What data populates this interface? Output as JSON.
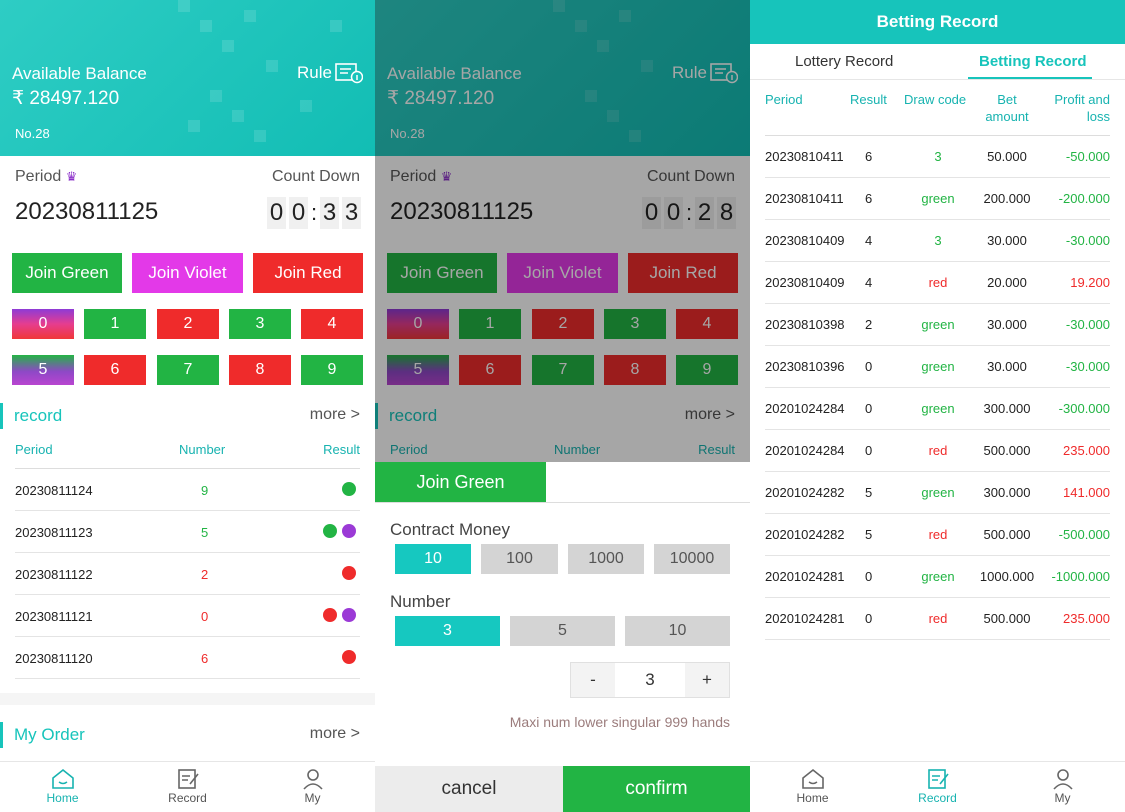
{
  "home": {
    "balance_label": "Available Balance",
    "balance_value": "₹ 28497.120",
    "rule_label": "Rule",
    "no_label": "No.28",
    "period_label": "Period",
    "countdown_label": "Count Down",
    "period_number": "20230811125",
    "countdown": [
      "0",
      "0",
      "3",
      "3"
    ],
    "join_buttons": [
      {
        "label": "Join Green"
      },
      {
        "label": "Join Violet"
      },
      {
        "label": "Join Red"
      }
    ],
    "numbers": [
      "0",
      "1",
      "2",
      "3",
      "4",
      "5",
      "6",
      "7",
      "8",
      "9"
    ],
    "record_title": "record",
    "more_label": "more >",
    "record_headers": {
      "period": "Period",
      "number": "Number",
      "result": "Result"
    },
    "records": [
      {
        "period": "20230811124",
        "number": "9",
        "num_color": "#22b444",
        "dots": [
          "#22b444"
        ]
      },
      {
        "period": "20230811123",
        "number": "5",
        "num_color": "#22b444",
        "dots": [
          "#22b444",
          "#9b3ad6"
        ]
      },
      {
        "period": "20230811122",
        "number": "2",
        "num_color": "#ef2b2b",
        "dots": [
          "#ef2b2b"
        ]
      },
      {
        "period": "20230811121",
        "number": "0",
        "num_color": "#ef2b2b",
        "dots": [
          "#ef2b2b",
          "#9b3ad6"
        ]
      },
      {
        "period": "20230811120",
        "number": "6",
        "num_color": "#ef2b2b",
        "dots": [
          "#ef2b2b"
        ]
      }
    ],
    "my_order_title": "My Order",
    "my_order_more": "more >"
  },
  "bet": {
    "countdown": [
      "0",
      "0",
      "2",
      "8"
    ],
    "sheet_title": "Join Green",
    "contract_label": "Contract Money",
    "contract_options": [
      "10",
      "100",
      "1000",
      "10000"
    ],
    "number_label": "Number",
    "number_options": [
      "3",
      "5",
      "10"
    ],
    "stepper": {
      "minus": "-",
      "value": "3",
      "plus": "+"
    },
    "hint": "Maxi num lower singular 999 hands",
    "cancel_label": "cancel",
    "confirm_label": "confirm"
  },
  "betting": {
    "title": "Betting Record",
    "tabs": [
      "Lottery Record",
      "Betting Record"
    ],
    "headers": {
      "period": "Period",
      "result": "Result",
      "draw_code": "Draw code",
      "bet_amount": "Bet amount",
      "profit": "Profit and loss"
    },
    "rows": [
      {
        "period": "20230810411",
        "result": "6",
        "draw": "3",
        "amount": "50.000",
        "profit": "-50.000",
        "pc": "g"
      },
      {
        "period": "20230810411",
        "result": "6",
        "draw": "green",
        "amount": "200.000",
        "profit": "-200.000",
        "pc": "g"
      },
      {
        "period": "20230810409",
        "result": "4",
        "draw": "3",
        "amount": "30.000",
        "profit": "-30.000",
        "pc": "g"
      },
      {
        "period": "20230810409",
        "result": "4",
        "draw": "red",
        "amount": "20.000",
        "profit": "19.200",
        "pc": "r"
      },
      {
        "period": "20230810398",
        "result": "2",
        "draw": "green",
        "amount": "30.000",
        "profit": "-30.000",
        "pc": "g"
      },
      {
        "period": "20230810396",
        "result": "0",
        "draw": "green",
        "amount": "30.000",
        "profit": "-30.000",
        "pc": "g"
      },
      {
        "period": "20201024284",
        "result": "0",
        "draw": "green",
        "amount": "300.000",
        "profit": "-300.000",
        "pc": "g"
      },
      {
        "period": "20201024284",
        "result": "0",
        "draw": "red",
        "amount": "500.000",
        "profit": "235.000",
        "pc": "r"
      },
      {
        "period": "20201024282",
        "result": "5",
        "draw": "green",
        "amount": "300.000",
        "profit": "141.000",
        "pc": "r"
      },
      {
        "period": "20201024282",
        "result": "5",
        "draw": "red",
        "amount": "500.000",
        "profit": "-500.000",
        "pc": "g"
      },
      {
        "period": "20201024281",
        "result": "0",
        "draw": "green",
        "amount": "1000.000",
        "profit": "-1000.000",
        "pc": "g"
      },
      {
        "period": "20201024281",
        "result": "0",
        "draw": "red",
        "amount": "500.000",
        "profit": "235.000",
        "pc": "r"
      }
    ]
  },
  "tabbar": {
    "home": "Home",
    "record": "Record",
    "my": "My"
  },
  "colors": {
    "accent": "#17c4bb",
    "green": "#22b444",
    "red": "#ef2b2b",
    "violet": "#e339e8"
  }
}
